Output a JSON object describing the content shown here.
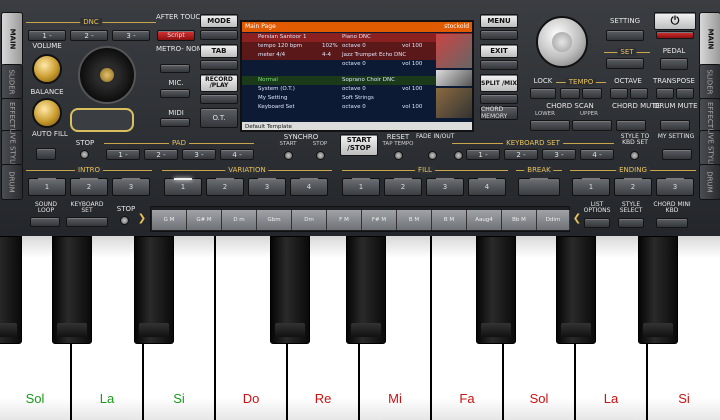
{
  "side_tabs": [
    "MAIN",
    "SLIDER",
    "EFFECT",
    "LIVE STYLE",
    "DRUM"
  ],
  "right_tabs": [
    "MAIN",
    "SLIDER",
    "EFFECT",
    "LIVE STYLE",
    "DRUM"
  ],
  "dnc": {
    "title": "DNC",
    "buttons": [
      "1 -",
      "2 -",
      "3 -"
    ]
  },
  "after_touch": {
    "label": "AFTER TOUCH",
    "value": "Script"
  },
  "volume": "VOLUME",
  "balance": "BALANCE",
  "auto_fill": "AUTO FILL",
  "stop": "STOP",
  "metronome": "METRO- NOME",
  "mic": "MIC.",
  "midi": "MIDI",
  "mode_buttons": [
    "MODE",
    "TAB",
    "RECORD /PLAY",
    "O.T."
  ],
  "screen": {
    "header_left": "Main Page",
    "header_right": "stockold",
    "rows": [
      {
        "a": "Persian Santoor 1",
        "b": "Piano DNC",
        "c": ""
      },
      {
        "a": "tempo 120 bpm",
        "b": "octave 0",
        "c": "vol 100",
        "d": "102%"
      },
      {
        "a": "meter 4/4",
        "b": "Jazz Trumpet Echo DNC",
        "c": "",
        "d": "4-4"
      },
      {
        "a": "",
        "b": "octave 0",
        "c": "vol 100"
      },
      {
        "a": "Normal",
        "b": "Soprano Choir DNC",
        "c": ""
      },
      {
        "a": "System (O.T.)",
        "b": "octave 0",
        "c": "vol 100"
      },
      {
        "a": "My Setting",
        "b": "Soft Strings",
        "c": ""
      },
      {
        "a": "Keyboard Set",
        "b": "octave 0",
        "c": "vol 100"
      }
    ],
    "footer": "Default Template"
  },
  "right_buttons": [
    "MENU",
    "EXIT",
    "SPLIT /MIX",
    "CHORD MEMORY"
  ],
  "setting": "SETTING",
  "set": "SET",
  "pedal": "PEDAL",
  "lock": "LOCK",
  "tempo": "TEMPO",
  "octave": "OCTAVE",
  "transpose": "TRANSPOSE",
  "chord_scan": {
    "label": "CHORD SCAN",
    "lower": "LOWER",
    "upper": "UPPER"
  },
  "chord_mute": "CHORD MUTE",
  "drum_mute": "DRUM MUTE",
  "pad": {
    "title": "PAD",
    "buttons": [
      "1 -",
      "2 -",
      "3 -",
      "4 -"
    ]
  },
  "synchro": {
    "label": "SYNCHRO",
    "start": "START",
    "stop": "STOP"
  },
  "start_stop": "START /STOP",
  "reset": {
    "label": "RESET",
    "sub": "TAP TEMPO"
  },
  "fade": "FADE IN/OUT",
  "keyboard_set": {
    "title": "KEYBOARD SET",
    "buttons": [
      "1 -",
      "2 -",
      "3 -",
      "4 -"
    ]
  },
  "style_to_kbd": "STYLE TO KBD SET",
  "my_setting": "MY SETTING",
  "intro": {
    "title": "INTRO",
    "buttons": [
      "1",
      "2",
      "3"
    ]
  },
  "variation": {
    "title": "VARIATION",
    "buttons": [
      "1",
      "2",
      "3",
      "4"
    ]
  },
  "fill": {
    "title": "FILL",
    "buttons": [
      "1",
      "2",
      "3",
      "4"
    ]
  },
  "break": "BREAK",
  "ending": {
    "title": "ENDING",
    "buttons": [
      "1",
      "2",
      "3"
    ]
  },
  "sound_loop": "SOUND LOOP",
  "keyboard_set2": "KEYBOARD SET",
  "stop2": "STOP",
  "chords": [
    "G M",
    "G# M",
    "D m",
    "Gbm",
    "Dm",
    "F M",
    "F# M",
    "B M",
    "B M",
    "Aaug4",
    "Bb M",
    "Ddim"
  ],
  "list_options": "LIST OPTIONS",
  "style_select": "STYLE SELECT",
  "chord_mini_kbd": "CHORD MINI KBD",
  "keys": [
    {
      "name": "Sol",
      "color": "#1a9a1a"
    },
    {
      "name": "La",
      "color": "#1a9a1a"
    },
    {
      "name": "Si",
      "color": "#1a9a1a"
    },
    {
      "name": "Do",
      "color": "#cc1111"
    },
    {
      "name": "Re",
      "color": "#cc1111"
    },
    {
      "name": "Mi",
      "color": "#cc1111"
    },
    {
      "name": "Fa",
      "color": "#cc1111"
    },
    {
      "name": "Sol",
      "color": "#cc1111"
    },
    {
      "name": "La",
      "color": "#cc1111"
    },
    {
      "name": "Si",
      "color": "#cc1111"
    }
  ],
  "colors": {
    "accent": "#e8c25a",
    "screen_bg": "#0c1a33",
    "header": "#e05a00"
  }
}
